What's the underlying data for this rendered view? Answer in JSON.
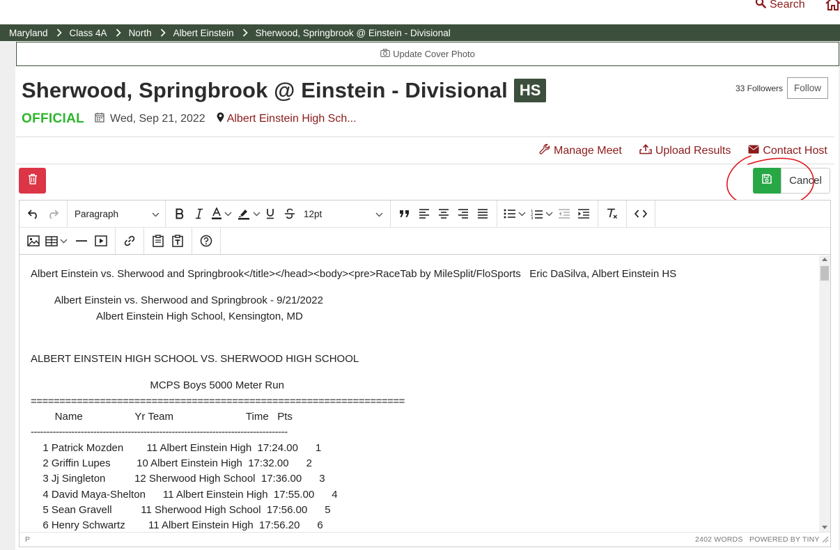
{
  "topnav": {
    "search_label": "Search",
    "search_icon": "search-icon",
    "home_icon": "home-icon",
    "accent_color": "#8b1a1a"
  },
  "breadcrumb": {
    "items": [
      "Maryland",
      "Class 4A",
      "North",
      "Albert Einstein",
      "Sherwood, Springbrook @ Einstein - Divisional"
    ],
    "background_color": "#3c4f3c"
  },
  "cover": {
    "label": "Update Cover Photo",
    "icon": "camera-icon"
  },
  "meet": {
    "title": "Sherwood, Springbrook @ Einstein - Divisional",
    "level_badge": "HS",
    "status": "OFFICIAL",
    "date": "Wed, Sep 21, 2022",
    "location": "Albert Einstein High Sch...",
    "followers": "33 Followers",
    "follow_label": "Follow"
  },
  "actions": [
    {
      "label": "Manage Meet",
      "icon": "wrench-icon"
    },
    {
      "label": "Upload Results",
      "icon": "upload-icon"
    },
    {
      "label": "Contact Host",
      "icon": "envelope-icon"
    }
  ],
  "buttons": {
    "delete_icon": "trash-icon",
    "save_icon": "save-icon",
    "cancel_label": "Cancel",
    "delete_color": "#dc3545",
    "save_color": "#28a745"
  },
  "editor": {
    "block_format": "Paragraph",
    "font_size": "12pt",
    "content_lines": [
      "Albert Einstein vs. Sherwood and Springbrook</title></head><body><pre>RaceTab by MileSplit/FloSports   Eric DaSilva, Albert Einstein HS",
      "    Albert Einstein vs. Sherwood and Springbrook - 9/21/2022",
      "           Albert Einstein High School, Kensington, MD",
      "ALBERT EINSTEIN HIGH SCHOOL VS. SHERWOOD HIGH SCHOOL",
      "                    MCPS Boys 5000 Meter Run",
      "=================================================================",
      "    Name                  Yr Team                         Time   Pts",
      "----------------------------------------------------------------------------------",
      "  1 Patrick Mozden        11 Albert Einstein High  17:24.00      1",
      "  2 Griffin Lupes         10 Albert Einstein High  17:32.00      2",
      "  3 Jj Singleton          12 Sherwood High School  17:36.00      3",
      "  4 David Maya-Shelton      11 Albert Einstein High  17:55.00      4",
      "  5 Sean Gravell          11 Sherwood High School  17:56.00      5",
      "  6 Henry Schwartz        11 Albert Einstein High  17:56.20      6"
    ],
    "status_path": "P",
    "word_count": "2402 WORDS",
    "powered_by": "POWERED BY TINY"
  }
}
